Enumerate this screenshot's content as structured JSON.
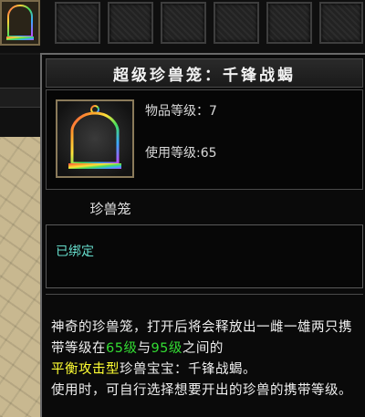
{
  "item": {
    "title": "超级珍兽笼：千锋战蝎",
    "level_label": "物品等级：7",
    "use_level_label": "使用等级:65",
    "type": "珍兽笼",
    "bound": "已绑定"
  },
  "description": {
    "p1": "神奇的珍兽笼，打开后将会释放出一雌一雄两只携带等级在",
    "lv1": "65级",
    "p2": "与",
    "lv2": "95级",
    "p3": "之间的",
    "attack_type": "平衡攻击型",
    "p4": "珍兽宝宝：千锋战蝎。",
    "p5": "使用时，可自行选择想要开出的珍兽的携带等级。"
  },
  "colors": {
    "highlight_green": "#33dd33",
    "highlight_yellow": "#ffff33",
    "bound_cyan": "#66ddcc"
  },
  "icons": [
    "birdcage-icon"
  ]
}
